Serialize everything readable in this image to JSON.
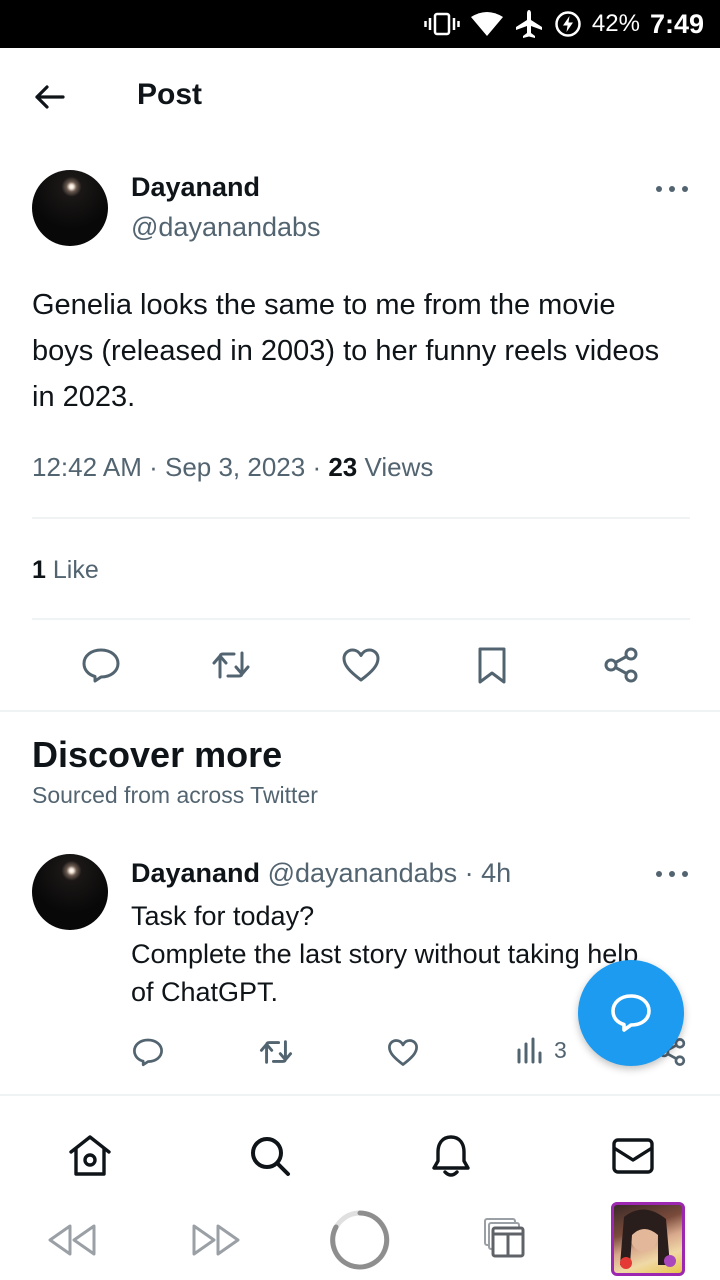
{
  "status_bar": {
    "battery": "42%",
    "time": "7:49"
  },
  "header": {
    "title": "Post"
  },
  "post": {
    "author_name": "Dayanand",
    "author_handle": "@dayanandabs",
    "text": "Genelia looks the same to me from the movie boys (released in 2003) to her funny reels videos in 2023.",
    "time": "12:42 AM",
    "date": "Sep 3, 2023",
    "views_count": "23",
    "views_label": "Views",
    "likes_count": "1",
    "likes_label": "Like"
  },
  "discover": {
    "title": "Discover more",
    "subtitle": "Sourced from across Twitter"
  },
  "related_tweet": {
    "author_name": "Dayanand",
    "meta": "@dayanandabs · 4h",
    "line1": "Task for today?",
    "line2": "Complete the last story without taking help",
    "line3": "of ChatGPT.",
    "views_count": "3"
  },
  "icons": {
    "post_actions": [
      "reply-icon",
      "retweet-icon",
      "like-icon",
      "bookmark-icon",
      "share-icon"
    ],
    "tweet_actions": [
      "reply-icon",
      "retweet-icon",
      "like-icon",
      "views-icon",
      "share-icon"
    ],
    "tab_bar": [
      "home-icon",
      "search-icon",
      "notifications-icon",
      "messages-icon"
    ],
    "browser_bar": [
      "back-icon",
      "forward-icon",
      "reload-icon",
      "tabs-icon"
    ]
  },
  "colors": {
    "accent": "#1d9bf0",
    "text": "#0f1419",
    "secondary": "#536471",
    "thumb_border": "#9c27b0"
  }
}
